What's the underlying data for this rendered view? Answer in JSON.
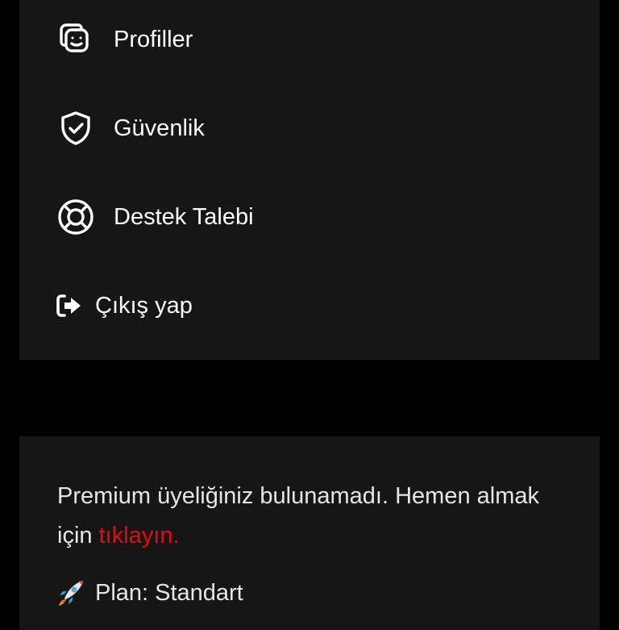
{
  "menu": {
    "items": [
      {
        "label": "Profiller",
        "icon": "profiles-icon"
      },
      {
        "label": "Güvenlik",
        "icon": "shield-check-icon"
      },
      {
        "label": "Destek Talebi",
        "icon": "lifebuoy-icon"
      },
      {
        "label": "Çıkış yap",
        "icon": "logout-icon"
      }
    ]
  },
  "premium": {
    "message": "Premium üyeliğiniz bulunamadı. Hemen almak için",
    "link_label": "tıklayın.",
    "plan_label": "Plan:",
    "plan_value": "Standart",
    "plan_icon": "rocket-icon",
    "link_color": "#e50914"
  },
  "colors": {
    "background": "#000000",
    "card": "#161616",
    "text": "#ffffff"
  }
}
